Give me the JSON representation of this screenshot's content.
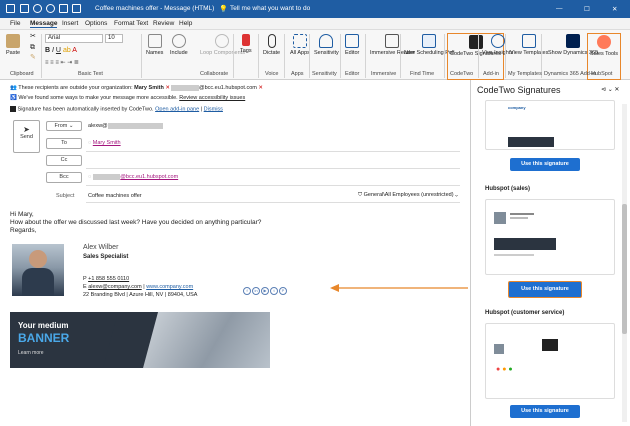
{
  "titlebar": {
    "title": "Coffee machines offer - Message (HTML)",
    "search": "Tell me what you want to do"
  },
  "menu": [
    "File",
    "Message",
    "Insert",
    "Options",
    "Format Text",
    "Review",
    "Help"
  ],
  "ribbon": {
    "font_name": "Arial",
    "font_size": "10",
    "paste": "Paste",
    "names": "Names",
    "include": "Include",
    "loop": "Loop Components",
    "tags": "Tags",
    "dictate": "Dictate",
    "allapps": "All Apps",
    "sensitivity": "Sensitivity",
    "editor": "Editor",
    "immersive": "Immersive Reader",
    "newpoll": "New Scheduling Poll",
    "codetwo": "CodeTwo Signatures",
    "viva": "Viva Insights",
    "viewtemplates": "View Templates",
    "dynamics": "Show Dynamics 365",
    "sales": "Sales Tools",
    "groups": [
      "Clipboard",
      "Basic Text",
      "Collaborate",
      "Voice",
      "Apps",
      "Sensitivity",
      "Editor",
      "Immersive",
      "Find Time",
      "CodeTwo",
      "Add-in",
      "My Templates",
      "Dynamics 365 Add-in",
      "HubSpot"
    ]
  },
  "notices": {
    "outside_pre": "These recipients are outside your organization:",
    "outside_name": "Mary Smith",
    "outside_email": "@bcc.eu1.hubspot.com",
    "accessible": "We've found some ways to make your message more accessible.",
    "accessible_link": "Review accessibility issues",
    "codetwo": "Signature has been automatically inserted by CodeTwo.",
    "open_addin": "Open add-in pane",
    "dismiss": "Dismiss"
  },
  "compose": {
    "send": "Send",
    "from": "From",
    "from_value": "alexw@",
    "to": "To",
    "to_value": "Mary Smith",
    "cc": "Cc",
    "bcc": "Bcc",
    "bcc_value": "@bcc.eu1.hubspot.com",
    "subject_label": "Subject",
    "subject": "Coffee machines offer",
    "sensitivity": "General\\All Employees (unrestricted)"
  },
  "email": {
    "greeting": "Hi Mary,",
    "line1": "How about the offer we discussed last week? Have you decided on anything particular?",
    "line2": "Regards,"
  },
  "signature": {
    "name": "Alex Wilber",
    "title": "Sales Specialist",
    "phone_label": "P",
    "phone": "+1 858 555 0110",
    "email_label": "E",
    "email": "alexw@company.com",
    "sep": "|",
    "website": "www.company.com",
    "address": "22 Branding Blvd | Azure Hill, NV | 89404, USA",
    "banner_line1": "Your medium",
    "banner_line2": "BANNER",
    "banner_cta": "Learn more"
  },
  "panel": {
    "title": "CodeTwo Signatures",
    "use_label": "Use this signature",
    "sec2": "Hubspot (sales)",
    "sec3": "Hubspot (customer service)",
    "thumb_company": "company",
    "thumb_banner": "Your medium BANNER"
  },
  "colors": {
    "accent": "#1f5da3",
    "highlight": "#e8872b",
    "button": "#1e6fd0"
  }
}
